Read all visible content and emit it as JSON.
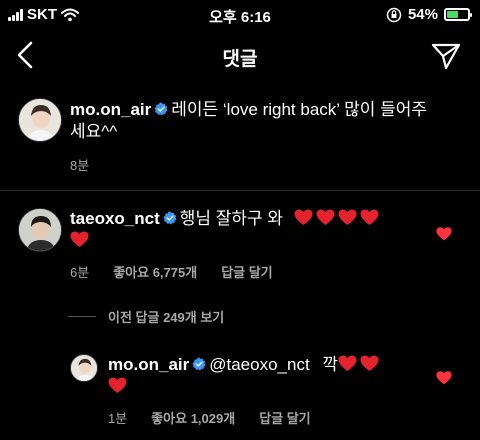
{
  "status_bar": {
    "carrier": "SKT",
    "time": "오후 6:16",
    "battery": "54%",
    "battery_level": 0.54
  },
  "header": {
    "title": "댓글"
  },
  "caption": {
    "username": "mo.on_air",
    "text_line1": "레이든 ‘love right back’ 많이 들어주",
    "text_line2": "세요^^",
    "time": "8분"
  },
  "comment": {
    "username": "taeoxo_nct",
    "text": "행님 잘하구 와",
    "time": "6분",
    "likes": "좋아요 6,775개",
    "reply_label": "답글 달기"
  },
  "view_replies": {
    "label": "이전 답글 249개 보기"
  },
  "reply": {
    "username": "mo.on_air",
    "mention": "@taeoxo_nct",
    "text": "깍",
    "time": "1분",
    "likes": "좋아요 1,029개",
    "reply_label": "답글 달기"
  },
  "colors": {
    "heart": "#ff3040",
    "verified": "#3897f0",
    "secondary_text": "#a8a8a8"
  }
}
